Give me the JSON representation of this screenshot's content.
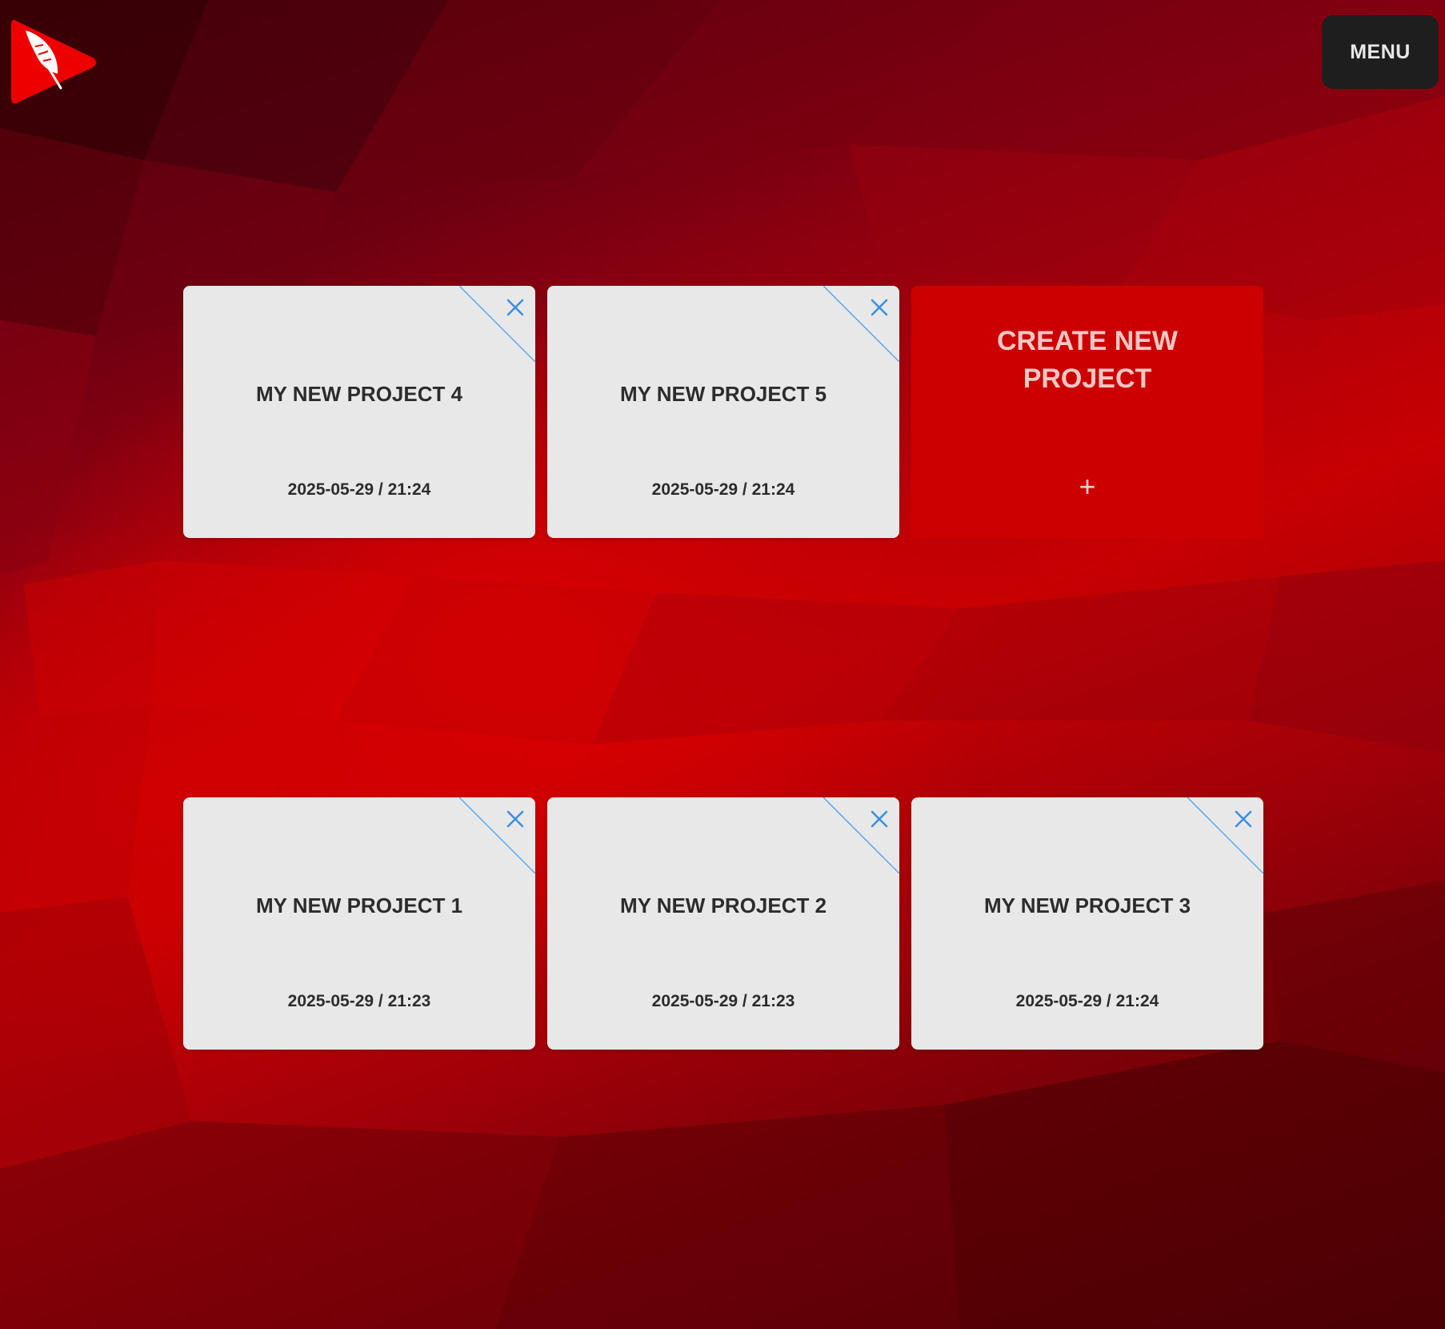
{
  "header": {
    "logo_icon": "feather-play-logo-icon",
    "menu_label": "MENU"
  },
  "colors": {
    "background": "#b00008",
    "card": "#e8e8e8",
    "create_card": "#cc0000",
    "close_icon": "#3a8fe0",
    "menu_bg": "#1e1e1e"
  },
  "projects": [
    {
      "title": "MY NEW PROJECT 4",
      "date": "2025-05-29 / 21:24",
      "close_icon": "close-icon"
    },
    {
      "title": "MY NEW PROJECT 5",
      "date": "2025-05-29 / 21:24",
      "close_icon": "close-icon"
    },
    {
      "title": "MY NEW PROJECT 1",
      "date": "2025-05-29 / 21:23",
      "close_icon": "close-icon"
    },
    {
      "title": "MY NEW PROJECT 2",
      "date": "2025-05-29 / 21:23",
      "close_icon": "close-icon"
    },
    {
      "title": "MY NEW PROJECT 3",
      "date": "2025-05-29 / 21:24",
      "close_icon": "close-icon"
    }
  ],
  "create_card": {
    "title": "CREATE NEW PROJECT",
    "plus": "+",
    "icon": "plus-icon"
  }
}
